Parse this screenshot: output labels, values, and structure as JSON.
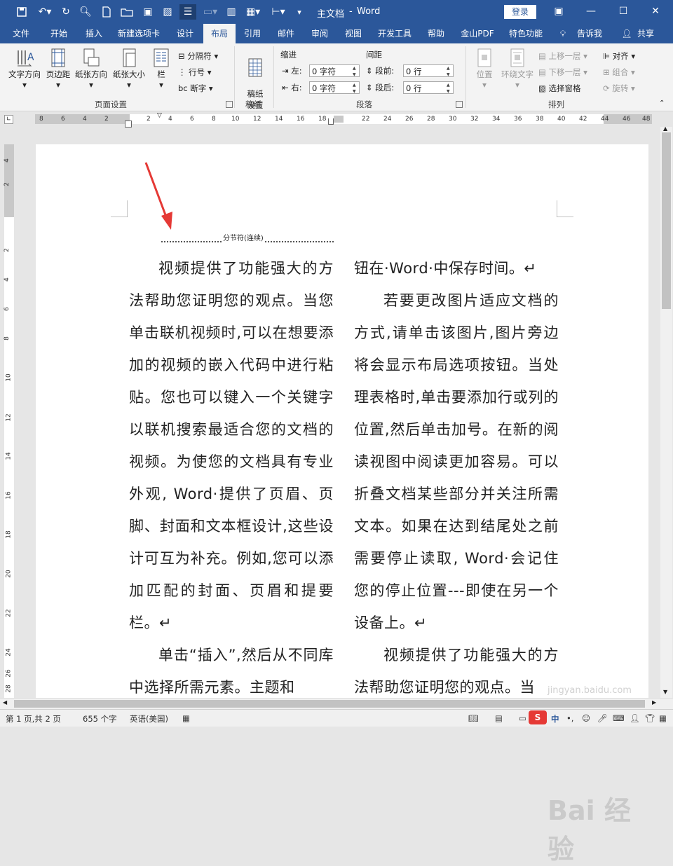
{
  "title_bar": {
    "doc_title": "主文档",
    "app_name": "Word",
    "login_label": "登录"
  },
  "menu_tabs": [
    "文件",
    "开始",
    "插入",
    "新建选项卡",
    "设计",
    "布局",
    "引用",
    "邮件",
    "审阅",
    "视图",
    "开发工具",
    "帮助",
    "金山PDF",
    "特色功能",
    "告诉我",
    "共享"
  ],
  "active_tab": "布局",
  "ribbon": {
    "page_setup": {
      "text_direction": "文字方向",
      "margins": "页边距",
      "orientation": "纸张方向",
      "size": "纸张大小",
      "columns": "栏",
      "breaks": "分隔符",
      "line_numbers": "行号",
      "hyphenation": "断字",
      "group_label": "页面设置"
    },
    "manuscript": {
      "setup": "稿纸\n设置",
      "group_label": "稿纸"
    },
    "paragraph": {
      "indent_label": "缩进",
      "spacing_label": "间距",
      "left_label": "左:",
      "right_label": "右:",
      "before_label": "段前:",
      "after_label": "段后:",
      "left_value": "0 字符",
      "right_value": "0 字符",
      "before_value": "0 行",
      "after_value": "0 行",
      "group_label": "段落"
    },
    "arrange": {
      "position": "位置",
      "wrap_text": "环绕文字",
      "bring_forward": "上移一层",
      "send_backward": "下移一层",
      "selection_pane": "选择窗格",
      "align": "对齐",
      "group": "组合",
      "rotate": "旋转",
      "group_label": "排列"
    }
  },
  "ruler": {
    "h_left": [
      "8",
      "6",
      "4",
      "2"
    ],
    "h_mid": [
      "2",
      "4",
      "6",
      "8",
      "10",
      "12",
      "14",
      "16",
      "18"
    ],
    "h_right": [
      "22",
      "24",
      "26",
      "28",
      "30",
      "32",
      "34",
      "36",
      "38"
    ],
    "h_far": [
      "40",
      "42",
      "44",
      "46",
      "48"
    ],
    "v_top": [
      "4",
      "2"
    ],
    "v_main": [
      "2",
      "4",
      "6",
      "8",
      "10",
      "12",
      "14",
      "16",
      "18",
      "20",
      "22",
      "24",
      "26",
      "28"
    ]
  },
  "document": {
    "section_break": "分节符(连续)",
    "col1": [
      "视频提供了功能强大的方法帮助您证明您的观点。当您单击联机视频时,可以在想要添加的视频的嵌入代码中进行粘贴。您也可以键入一个关键字以联机搜索最适合您的文档的视频。为使您的文档具有专业外观, Word·提供了页眉、页脚、封面和文本框设计,这些设计可互为补充。例如,您可以添加匹配的封面、页眉和提要栏。↵",
      "单击“插入”,然后从不同库中选择所需元素。主题和"
    ],
    "col2": [
      "钮在·Word·中保存时间。↵",
      "若要更改图片适应文档的方式,请单击该图片,图片旁边将会显示布局选项按钮。当处理表格时,单击要添加行或列的位置,然后单击加号。在新的阅读视图中阅读更加容易。可以折叠文档某些部分并关注所需文本。如果在达到结尾处之前需要停止读取, Word·会记住您的停止位置---即使在另一个设备上。↵",
      "视频提供了功能强大的方法帮助您证明您的观点。当"
    ]
  },
  "status_bar": {
    "page": "第 1 页,共 2 页",
    "words": "655 个字",
    "language": "英语(美国)",
    "ime": "中"
  },
  "watermark": {
    "text": "Bai 经验",
    "url": "jingyan.baidu.com"
  },
  "colors": {
    "word_blue": "#2b579a",
    "arrow_red": "#e53935"
  }
}
